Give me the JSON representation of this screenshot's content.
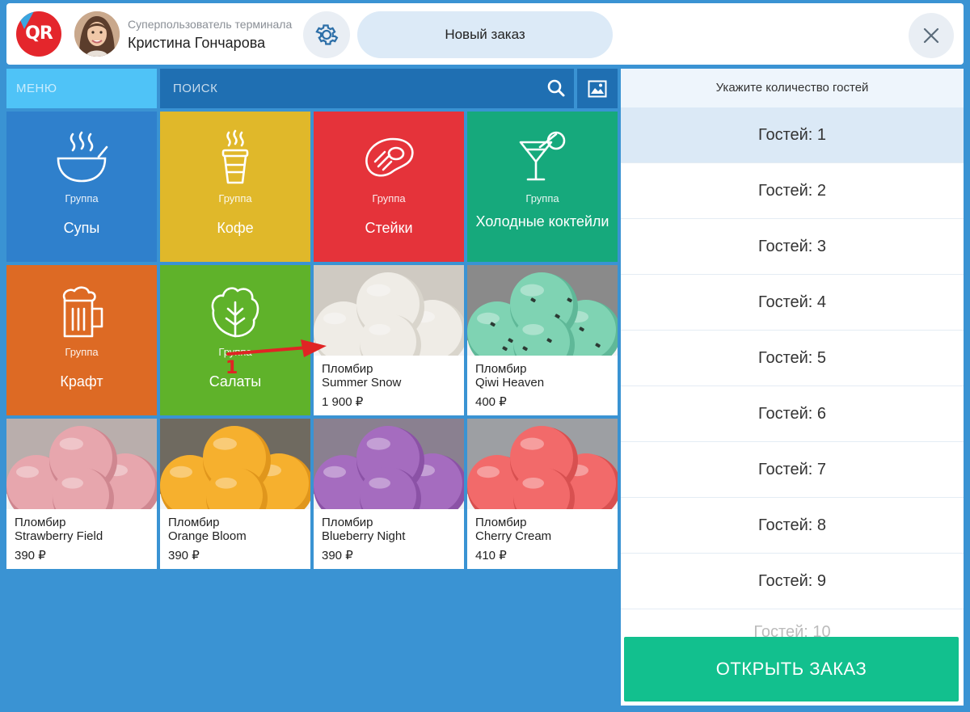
{
  "header": {
    "logo_text": "QR",
    "user_role": "Суперпользователь терминала",
    "user_name": "Кристина Гончарова",
    "new_order_label": "Новый заказ"
  },
  "toolbar": {
    "menu_label": "МЕНЮ",
    "search_placeholder": "ПОИСК"
  },
  "groups": [
    {
      "sub": "Группа",
      "name": "Супы",
      "color": "#2f80cc",
      "icon": "soup-icon"
    },
    {
      "sub": "Группа",
      "name": "Кофе",
      "color": "#e0b82a",
      "icon": "coffee-cup-icon"
    },
    {
      "sub": "Группа",
      "name": "Стейки",
      "color": "#e5333a",
      "icon": "steak-icon"
    },
    {
      "sub": "Группа",
      "name": "Холодные коктейли",
      "color": "#16a97c",
      "icon": "cocktail-icon"
    },
    {
      "sub": "Группа",
      "name": "Крафт",
      "color": "#dd6a24",
      "icon": "beer-mug-icon"
    },
    {
      "sub": "Группа",
      "name": "Салаты",
      "color": "#5fb22a",
      "icon": "lettuce-icon"
    }
  ],
  "products": [
    {
      "line1": "Пломбир",
      "line2": "Summer Snow",
      "price": "1 900 ₽",
      "scoop": "#efece6",
      "scoop_dark": "#d9d5cc",
      "bg": "#cfcac2",
      "chips": false
    },
    {
      "line1": "Пломбир",
      "line2": "Qiwi Heaven",
      "price": "400 ₽",
      "scoop": "#7fd3b3",
      "scoop_dark": "#5fb898",
      "bg": "#8a8a8a",
      "chips": true
    },
    {
      "line1": "Пломбир",
      "line2": "Strawberry Field",
      "price": "390 ₽",
      "scoop": "#e7a6ad",
      "scoop_dark": "#cf8790",
      "bg": "#b9aeac",
      "chips": false
    },
    {
      "line1": "Пломбир",
      "line2": "Orange Bloom",
      "price": "390 ₽",
      "scoop": "#f6b02e",
      "scoop_dark": "#e0961c",
      "bg": "#6f6a60",
      "chips": false
    },
    {
      "line1": "Пломбир",
      "line2": "Blueberry Night",
      "price": "390 ₽",
      "scoop": "#a56cbf",
      "scoop_dark": "#8b52a6",
      "bg": "#8a8090",
      "chips": false
    },
    {
      "line1": "Пломбир",
      "line2": "Cherry Cream",
      "price": "410 ₽",
      "scoop": "#f26a6a",
      "scoop_dark": "#d85050",
      "bg": "#9d9fa3",
      "chips": false
    }
  ],
  "guests": {
    "title": "Укажите количество гостей",
    "items": [
      "Гостей: 1",
      "Гостей: 2",
      "Гостей: 3",
      "Гостей: 4",
      "Гостей: 5",
      "Гостей: 6",
      "Гостей: 7",
      "Гостей: 8",
      "Гостей: 9",
      "Гостей: 10"
    ],
    "active_index": 0,
    "open_order_label": "ОТКРЫТЬ ЗАКАЗ"
  },
  "annotation": {
    "number": "1",
    "color": "#e02424"
  }
}
